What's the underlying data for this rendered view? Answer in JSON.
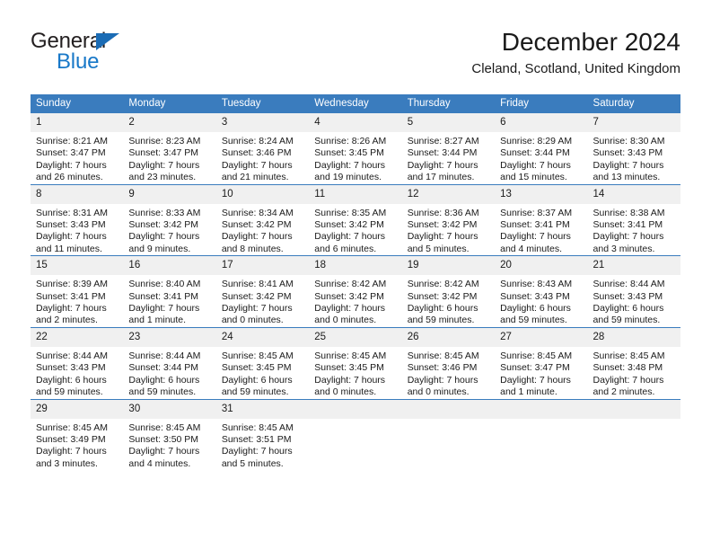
{
  "logo": {
    "word1": "General",
    "word2": "Blue",
    "triangle_color": "#1b6cb5",
    "word2_color": "#1878c8"
  },
  "header": {
    "title": "December 2024",
    "subtitle": "Cleland, Scotland, United Kingdom"
  },
  "theme": {
    "header_blue": "#3a7cbe",
    "daynum_gray": "#f0f0f0",
    "text": "#1a1a1a"
  },
  "weekday_headers": [
    "Sunday",
    "Monday",
    "Tuesday",
    "Wednesday",
    "Thursday",
    "Friday",
    "Saturday"
  ],
  "weeks": [
    [
      {
        "day": "1",
        "sunrise": "Sunrise: 8:21 AM",
        "sunset": "Sunset: 3:47 PM",
        "daylight1": "Daylight: 7 hours",
        "daylight2": "and 26 minutes."
      },
      {
        "day": "2",
        "sunrise": "Sunrise: 8:23 AM",
        "sunset": "Sunset: 3:47 PM",
        "daylight1": "Daylight: 7 hours",
        "daylight2": "and 23 minutes."
      },
      {
        "day": "3",
        "sunrise": "Sunrise: 8:24 AM",
        "sunset": "Sunset: 3:46 PM",
        "daylight1": "Daylight: 7 hours",
        "daylight2": "and 21 minutes."
      },
      {
        "day": "4",
        "sunrise": "Sunrise: 8:26 AM",
        "sunset": "Sunset: 3:45 PM",
        "daylight1": "Daylight: 7 hours",
        "daylight2": "and 19 minutes."
      },
      {
        "day": "5",
        "sunrise": "Sunrise: 8:27 AM",
        "sunset": "Sunset: 3:44 PM",
        "daylight1": "Daylight: 7 hours",
        "daylight2": "and 17 minutes."
      },
      {
        "day": "6",
        "sunrise": "Sunrise: 8:29 AM",
        "sunset": "Sunset: 3:44 PM",
        "daylight1": "Daylight: 7 hours",
        "daylight2": "and 15 minutes."
      },
      {
        "day": "7",
        "sunrise": "Sunrise: 8:30 AM",
        "sunset": "Sunset: 3:43 PM",
        "daylight1": "Daylight: 7 hours",
        "daylight2": "and 13 minutes."
      }
    ],
    [
      {
        "day": "8",
        "sunrise": "Sunrise: 8:31 AM",
        "sunset": "Sunset: 3:43 PM",
        "daylight1": "Daylight: 7 hours",
        "daylight2": "and 11 minutes."
      },
      {
        "day": "9",
        "sunrise": "Sunrise: 8:33 AM",
        "sunset": "Sunset: 3:42 PM",
        "daylight1": "Daylight: 7 hours",
        "daylight2": "and 9 minutes."
      },
      {
        "day": "10",
        "sunrise": "Sunrise: 8:34 AM",
        "sunset": "Sunset: 3:42 PM",
        "daylight1": "Daylight: 7 hours",
        "daylight2": "and 8 minutes."
      },
      {
        "day": "11",
        "sunrise": "Sunrise: 8:35 AM",
        "sunset": "Sunset: 3:42 PM",
        "daylight1": "Daylight: 7 hours",
        "daylight2": "and 6 minutes."
      },
      {
        "day": "12",
        "sunrise": "Sunrise: 8:36 AM",
        "sunset": "Sunset: 3:42 PM",
        "daylight1": "Daylight: 7 hours",
        "daylight2": "and 5 minutes."
      },
      {
        "day": "13",
        "sunrise": "Sunrise: 8:37 AM",
        "sunset": "Sunset: 3:41 PM",
        "daylight1": "Daylight: 7 hours",
        "daylight2": "and 4 minutes."
      },
      {
        "day": "14",
        "sunrise": "Sunrise: 8:38 AM",
        "sunset": "Sunset: 3:41 PM",
        "daylight1": "Daylight: 7 hours",
        "daylight2": "and 3 minutes."
      }
    ],
    [
      {
        "day": "15",
        "sunrise": "Sunrise: 8:39 AM",
        "sunset": "Sunset: 3:41 PM",
        "daylight1": "Daylight: 7 hours",
        "daylight2": "and 2 minutes."
      },
      {
        "day": "16",
        "sunrise": "Sunrise: 8:40 AM",
        "sunset": "Sunset: 3:41 PM",
        "daylight1": "Daylight: 7 hours",
        "daylight2": "and 1 minute."
      },
      {
        "day": "17",
        "sunrise": "Sunrise: 8:41 AM",
        "sunset": "Sunset: 3:42 PM",
        "daylight1": "Daylight: 7 hours",
        "daylight2": "and 0 minutes."
      },
      {
        "day": "18",
        "sunrise": "Sunrise: 8:42 AM",
        "sunset": "Sunset: 3:42 PM",
        "daylight1": "Daylight: 7 hours",
        "daylight2": "and 0 minutes."
      },
      {
        "day": "19",
        "sunrise": "Sunrise: 8:42 AM",
        "sunset": "Sunset: 3:42 PM",
        "daylight1": "Daylight: 6 hours",
        "daylight2": "and 59 minutes."
      },
      {
        "day": "20",
        "sunrise": "Sunrise: 8:43 AM",
        "sunset": "Sunset: 3:43 PM",
        "daylight1": "Daylight: 6 hours",
        "daylight2": "and 59 minutes."
      },
      {
        "day": "21",
        "sunrise": "Sunrise: 8:44 AM",
        "sunset": "Sunset: 3:43 PM",
        "daylight1": "Daylight: 6 hours",
        "daylight2": "and 59 minutes."
      }
    ],
    [
      {
        "day": "22",
        "sunrise": "Sunrise: 8:44 AM",
        "sunset": "Sunset: 3:43 PM",
        "daylight1": "Daylight: 6 hours",
        "daylight2": "and 59 minutes."
      },
      {
        "day": "23",
        "sunrise": "Sunrise: 8:44 AM",
        "sunset": "Sunset: 3:44 PM",
        "daylight1": "Daylight: 6 hours",
        "daylight2": "and 59 minutes."
      },
      {
        "day": "24",
        "sunrise": "Sunrise: 8:45 AM",
        "sunset": "Sunset: 3:45 PM",
        "daylight1": "Daylight: 6 hours",
        "daylight2": "and 59 minutes."
      },
      {
        "day": "25",
        "sunrise": "Sunrise: 8:45 AM",
        "sunset": "Sunset: 3:45 PM",
        "daylight1": "Daylight: 7 hours",
        "daylight2": "and 0 minutes."
      },
      {
        "day": "26",
        "sunrise": "Sunrise: 8:45 AM",
        "sunset": "Sunset: 3:46 PM",
        "daylight1": "Daylight: 7 hours",
        "daylight2": "and 0 minutes."
      },
      {
        "day": "27",
        "sunrise": "Sunrise: 8:45 AM",
        "sunset": "Sunset: 3:47 PM",
        "daylight1": "Daylight: 7 hours",
        "daylight2": "and 1 minute."
      },
      {
        "day": "28",
        "sunrise": "Sunrise: 8:45 AM",
        "sunset": "Sunset: 3:48 PM",
        "daylight1": "Daylight: 7 hours",
        "daylight2": "and 2 minutes."
      }
    ],
    [
      {
        "day": "29",
        "sunrise": "Sunrise: 8:45 AM",
        "sunset": "Sunset: 3:49 PM",
        "daylight1": "Daylight: 7 hours",
        "daylight2": "and 3 minutes."
      },
      {
        "day": "30",
        "sunrise": "Sunrise: 8:45 AM",
        "sunset": "Sunset: 3:50 PM",
        "daylight1": "Daylight: 7 hours",
        "daylight2": "and 4 minutes."
      },
      {
        "day": "31",
        "sunrise": "Sunrise: 8:45 AM",
        "sunset": "Sunset: 3:51 PM",
        "daylight1": "Daylight: 7 hours",
        "daylight2": "and 5 minutes."
      },
      {
        "day": "",
        "sunrise": "",
        "sunset": "",
        "daylight1": "",
        "daylight2": ""
      },
      {
        "day": "",
        "sunrise": "",
        "sunset": "",
        "daylight1": "",
        "daylight2": ""
      },
      {
        "day": "",
        "sunrise": "",
        "sunset": "",
        "daylight1": "",
        "daylight2": ""
      },
      {
        "day": "",
        "sunrise": "",
        "sunset": "",
        "daylight1": "",
        "daylight2": ""
      }
    ]
  ]
}
